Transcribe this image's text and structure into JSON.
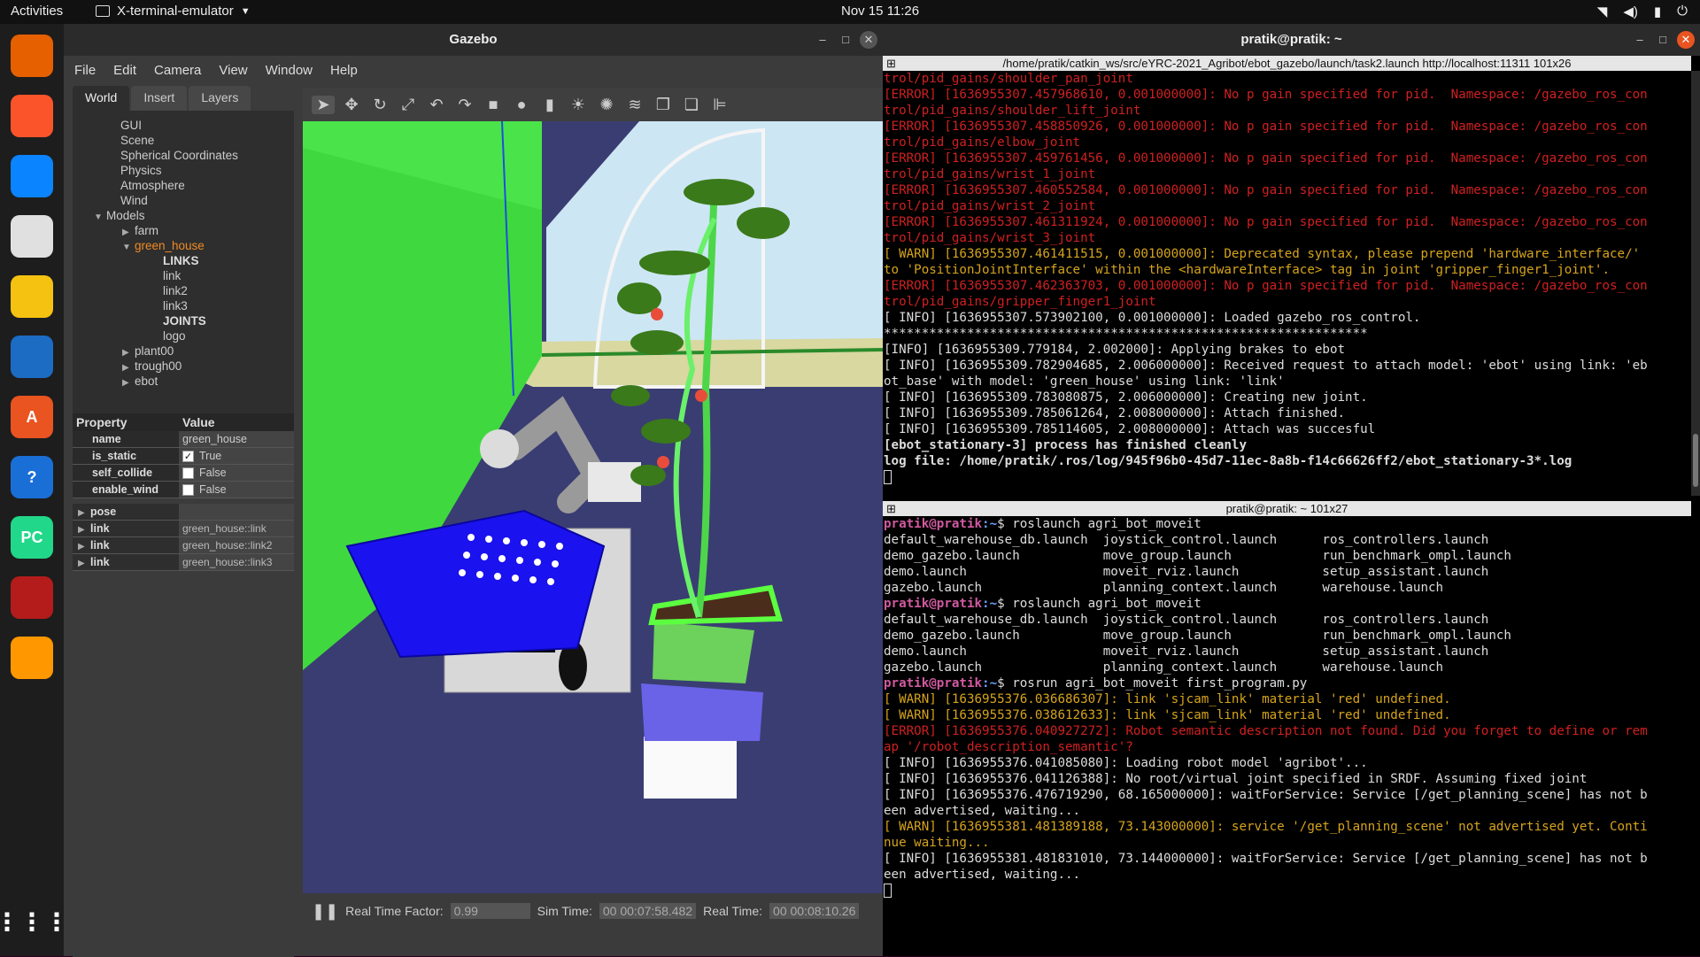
{
  "topbar": {
    "activities": "Activities",
    "app": "X-terminal-emulator",
    "clock": "Nov 15  11:26"
  },
  "dock": [
    {
      "name": "firefox",
      "label": "",
      "color": "#e66000"
    },
    {
      "name": "brave",
      "label": "",
      "color": "#fb542b"
    },
    {
      "name": "thunderbird",
      "label": "",
      "color": "#0a84ff"
    },
    {
      "name": "files",
      "label": "",
      "color": "#e0e0e0"
    },
    {
      "name": "rhythmbox",
      "label": "",
      "color": "#f5c211"
    },
    {
      "name": "writer",
      "label": "",
      "color": "#1c6cc4"
    },
    {
      "name": "software",
      "label": "A",
      "color": "#e95420"
    },
    {
      "name": "help",
      "label": "?",
      "color": "#1a6fd6"
    },
    {
      "name": "pycharm",
      "label": "PC",
      "color": "#21d789"
    },
    {
      "name": "terminal",
      "label": "",
      "color": "#b41b1b"
    },
    {
      "name": "sublime",
      "label": "",
      "color": "#ff9800"
    }
  ],
  "gazebo": {
    "title": "Gazebo",
    "menu": [
      "File",
      "Edit",
      "Camera",
      "View",
      "Window",
      "Help"
    ],
    "tabs": [
      "World",
      "Insert",
      "Layers"
    ],
    "tree": [
      {
        "label": "GUI",
        "indent": 0,
        "arrow": ""
      },
      {
        "label": "Scene",
        "indent": 0,
        "arrow": ""
      },
      {
        "label": "Spherical Coordinates",
        "indent": 0,
        "arrow": ""
      },
      {
        "label": "Physics",
        "indent": 0,
        "arrow": ""
      },
      {
        "label": "Atmosphere",
        "indent": 0,
        "arrow": ""
      },
      {
        "label": "Wind",
        "indent": 0,
        "arrow": ""
      },
      {
        "label": "Models",
        "indent": -1,
        "arrow": "▼"
      },
      {
        "label": "farm",
        "indent": 1,
        "arrow": "▶"
      },
      {
        "label": "green_house",
        "indent": 1,
        "arrow": "▼",
        "selected": true
      },
      {
        "label": "LINKS",
        "indent": 3,
        "arrow": "",
        "bold": true
      },
      {
        "label": "link",
        "indent": 3,
        "arrow": ""
      },
      {
        "label": "link2",
        "indent": 3,
        "arrow": ""
      },
      {
        "label": "link3",
        "indent": 3,
        "arrow": ""
      },
      {
        "label": "JOINTS",
        "indent": 3,
        "arrow": "",
        "bold": true
      },
      {
        "label": "logo",
        "indent": 3,
        "arrow": ""
      },
      {
        "label": "plant00",
        "indent": 1,
        "arrow": "▶"
      },
      {
        "label": "trough00",
        "indent": 1,
        "arrow": "▶"
      },
      {
        "label": "ebot",
        "indent": 1,
        "arrow": "▶"
      }
    ],
    "props_header": {
      "property": "Property",
      "value": "Value"
    },
    "props": [
      {
        "key": "name",
        "value": "green_house",
        "check": ""
      },
      {
        "key": "is_static",
        "value": "True",
        "check": "✓"
      },
      {
        "key": "self_collide",
        "value": "False",
        "check": " "
      },
      {
        "key": "enable_wind",
        "value": "False",
        "check": " "
      }
    ],
    "expand": [
      {
        "key": "pose",
        "value": ""
      },
      {
        "key": "link",
        "value": "green_house::link"
      },
      {
        "key": "link",
        "value": "green_house::link2"
      },
      {
        "key": "link",
        "value": "green_house::link3"
      }
    ],
    "status": {
      "rtf_label": "Real Time Factor:",
      "rtf": "0.99",
      "sim_label": "Sim Time:",
      "sim": "00 00:07:58.482",
      "real_label": "Real Time:",
      "real": "00 00:08:10.26"
    }
  },
  "terminal": {
    "title": "pratik@pratik: ~",
    "top_pane_title": "/home/pratik/catkin_ws/src/eYRC-2021_Agribot/ebot_gazebo/launch/task2.launch http://localhost:11311 101x26",
    "bottom_pane_title": "pratik@pratik: ~ 101x27",
    "top_lines": [
      {
        "t": "trol/pid_gains/shoulder_pan_joint",
        "c": "err"
      },
      {
        "t": "[ERROR] [1636955307.457968610, 0.001000000]: No p gain specified for pid.  Namespace: /gazebo_ros_con",
        "c": "err"
      },
      {
        "t": "trol/pid_gains/shoulder_lift_joint",
        "c": "err"
      },
      {
        "t": "[ERROR] [1636955307.458850926, 0.001000000]: No p gain specified for pid.  Namespace: /gazebo_ros_con",
        "c": "err"
      },
      {
        "t": "trol/pid_gains/elbow_joint",
        "c": "err"
      },
      {
        "t": "[ERROR] [1636955307.459761456, 0.001000000]: No p gain specified for pid.  Namespace: /gazebo_ros_con",
        "c": "err"
      },
      {
        "t": "trol/pid_gains/wrist_1_joint",
        "c": "err"
      },
      {
        "t": "[ERROR] [1636955307.460552584, 0.001000000]: No p gain specified for pid.  Namespace: /gazebo_ros_con",
        "c": "err"
      },
      {
        "t": "trol/pid_gains/wrist_2_joint",
        "c": "err"
      },
      {
        "t": "[ERROR] [1636955307.461311924, 0.001000000]: No p gain specified for pid.  Namespace: /gazebo_ros_con",
        "c": "err"
      },
      {
        "t": "trol/pid_gains/wrist_3_joint",
        "c": "err"
      },
      {
        "t": "[ WARN] [1636955307.461411515, 0.001000000]: Deprecated syntax, please prepend 'hardware_interface/'",
        "c": "warn"
      },
      {
        "t": "to 'PositionJointInterface' within the <hardwareInterface> tag in joint 'gripper_finger1_joint'.",
        "c": "warn"
      },
      {
        "t": "[ERROR] [1636955307.462363703, 0.001000000]: No p gain specified for pid.  Namespace: /gazebo_ros_con",
        "c": "err"
      },
      {
        "t": "trol/pid_gains/gripper_finger1_joint",
        "c": "err"
      },
      {
        "t": "[ INFO] [1636955307.573902100, 0.001000000]: Loaded gazebo_ros_control.",
        "c": ""
      },
      {
        "t": "****************************************************************",
        "c": ""
      },
      {
        "t": "[INFO] [1636955309.779184, 2.002000]: Applying brakes to ebot",
        "c": ""
      },
      {
        "t": "[ INFO] [1636955309.782904685, 2.006000000]: Received request to attach model: 'ebot' using link: 'eb",
        "c": ""
      },
      {
        "t": "ot_base' with model: 'green_house' using link: 'link'",
        "c": ""
      },
      {
        "t": "[ INFO] [1636955309.783080875, 2.006000000]: Creating new joint.",
        "c": ""
      },
      {
        "t": "[ INFO] [1636955309.785061264, 2.008000000]: Attach finished.",
        "c": ""
      },
      {
        "t": "[ INFO] [1636955309.785114605, 2.008000000]: Attach was succesful",
        "c": ""
      },
      {
        "t": "[ebot_stationary-3] process has finished cleanly",
        "c": "bold"
      },
      {
        "t": "log file: /home/pratik/.ros/log/945f96b0-45d7-11ec-8a8b-f14c66626ff2/ebot_stationary-3*.log",
        "c": "bold"
      }
    ],
    "prompt_user": "pratik@pratik",
    "prompt_path": ":~",
    "bottom_lines": [
      {
        "p": true,
        "t": "$ roslaunch agri_bot_moveit",
        "c": ""
      },
      {
        "t": "default_warehouse_db.launch  joystick_control.launch      ros_controllers.launch",
        "c": ""
      },
      {
        "t": "demo_gazebo.launch           move_group.launch            run_benchmark_ompl.launch",
        "c": ""
      },
      {
        "t": "demo.launch                  moveit_rviz.launch           setup_assistant.launch",
        "c": ""
      },
      {
        "t": "gazebo.launch                planning_context.launch      warehouse.launch",
        "c": ""
      },
      {
        "p": true,
        "t": "$ roslaunch agri_bot_moveit",
        "c": ""
      },
      {
        "t": "default_warehouse_db.launch  joystick_control.launch      ros_controllers.launch",
        "c": ""
      },
      {
        "t": "demo_gazebo.launch           move_group.launch            run_benchmark_ompl.launch",
        "c": ""
      },
      {
        "t": "demo.launch                  moveit_rviz.launch           setup_assistant.launch",
        "c": ""
      },
      {
        "t": "gazebo.launch                planning_context.launch      warehouse.launch",
        "c": ""
      },
      {
        "p": true,
        "t": "$ rosrun agri_bot_moveit first_program.py",
        "c": ""
      },
      {
        "t": "[ WARN] [1636955376.036686307]: link 'sjcam_link' material 'red' undefined.",
        "c": "warn"
      },
      {
        "t": "[ WARN] [1636955376.038612633]: link 'sjcam_link' material 'red' undefined.",
        "c": "warn"
      },
      {
        "t": "[ERROR] [1636955376.040927272]: Robot semantic description not found. Did you forget to define or rem",
        "c": "err"
      },
      {
        "t": "ap '/robot_description_semantic'?",
        "c": "err"
      },
      {
        "t": "[ INFO] [1636955376.041085080]: Loading robot model 'agribot'...",
        "c": ""
      },
      {
        "t": "[ INFO] [1636955376.041126388]: No root/virtual joint specified in SRDF. Assuming fixed joint",
        "c": ""
      },
      {
        "t": "[ INFO] [1636955376.476719290, 68.165000000]: waitForService: Service [/get_planning_scene] has not b",
        "c": ""
      },
      {
        "t": "een advertised, waiting...",
        "c": ""
      },
      {
        "t": "[ WARN] [1636955381.481389188, 73.143000000]: service '/get_planning_scene' not advertised yet. Conti",
        "c": "warn"
      },
      {
        "t": "nue waiting...",
        "c": "warn"
      },
      {
        "t": "[ INFO] [1636955381.481831010, 73.144000000]: waitForService: Service [/get_planning_scene] has not b",
        "c": ""
      },
      {
        "t": "een advertised, waiting...",
        "c": ""
      }
    ]
  }
}
